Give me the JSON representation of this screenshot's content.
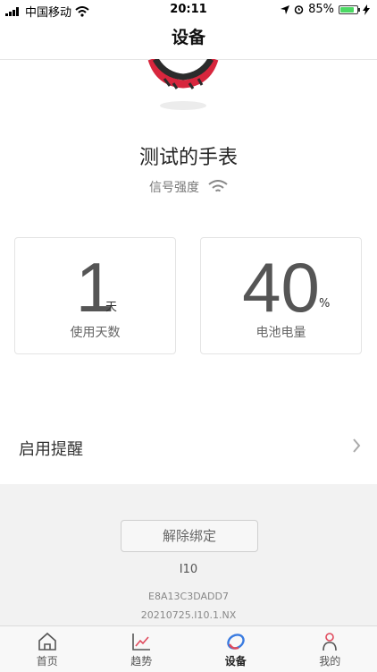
{
  "status": {
    "carrier": "中国移动",
    "time": "20:11",
    "battery": "85%",
    "battery_level": 0.85
  },
  "nav": {
    "title": "设备"
  },
  "device": {
    "name": "测试的手表",
    "signal_label": "信号强度"
  },
  "stats": {
    "days": {
      "value": "1",
      "unit": "天",
      "label": "使用天数"
    },
    "battery": {
      "value": "40",
      "unit": "%",
      "label": "电池电量"
    }
  },
  "reminder": {
    "label": "启用提醒"
  },
  "footer": {
    "unbind_label": "解除绑定",
    "model": "I10",
    "mac": "E8A13C3DADD7",
    "firmware": "20210725.I10.1.NX"
  },
  "tabs": [
    {
      "label": "首页",
      "icon": "home-icon"
    },
    {
      "label": "趋势",
      "icon": "trend-icon"
    },
    {
      "label": "设备",
      "icon": "device-icon",
      "active": true
    },
    {
      "label": "我的",
      "icon": "profile-icon"
    }
  ]
}
